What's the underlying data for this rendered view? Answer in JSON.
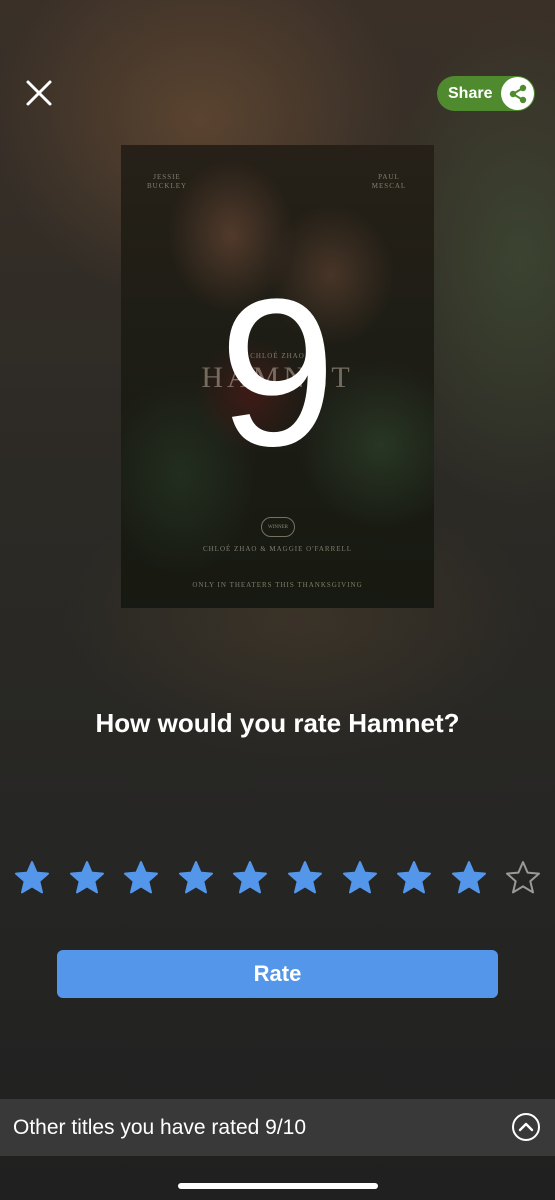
{
  "header": {
    "close_icon": "close-icon",
    "share_label": "Share",
    "share_icon": "share-icon",
    "share_color": "#4f8a2e"
  },
  "poster": {
    "movie_title": "HAMNET",
    "actor_left_first": "JESSIE",
    "actor_left_last": "BUCKLEY",
    "actor_right_first": "PAUL",
    "actor_right_last": "MESCAL",
    "director": "CHLOÉ ZHAO",
    "credits": "CHLOÉ ZHAO & MAGGIE O'FARRELL",
    "badge": "WINNER",
    "release": "ONLY IN THEATERS THIS THANKSGIVING"
  },
  "rating": {
    "value": "9",
    "max": 10,
    "filled_stars": 9,
    "question": "How would you rate Hamnet?",
    "star_color": "#5496ea",
    "empty_star_color": "#9a9a9a"
  },
  "actions": {
    "rate_label": "Rate",
    "rate_color": "#5496ea"
  },
  "footer": {
    "other_titles_label": "Other titles you have rated 9/10",
    "expand_icon": "chevron-up-circle-icon"
  }
}
